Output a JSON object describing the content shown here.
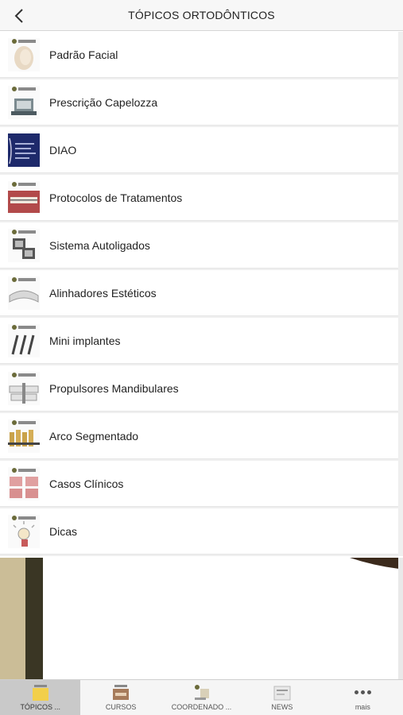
{
  "header": {
    "title": "TÓPICOS ORTODÔNTICOS",
    "back_icon": "chevron-left-icon"
  },
  "items": [
    {
      "label": "Padrão Facial",
      "icon": "facial-profile-thumb"
    },
    {
      "label": "Prescrição Capelozza",
      "icon": "bracket-thumb"
    },
    {
      "label": "DIAO",
      "icon": "diao-thumb"
    },
    {
      "label": "Protocolos de Tratamentos",
      "icon": "teeth-photo-thumb"
    },
    {
      "label": "Sistema Autoligados",
      "icon": "self-ligating-bracket-thumb"
    },
    {
      "label": "Alinhadores Estéticos",
      "icon": "aligner-thumb"
    },
    {
      "label": "Mini implantes",
      "icon": "mini-implant-thumb"
    },
    {
      "label": "Propulsores Mandibulares",
      "icon": "mandibular-propulsor-thumb"
    },
    {
      "label": "Arco Segmentado",
      "icon": "segmented-arch-thumb"
    },
    {
      "label": "Casos Clínicos",
      "icon": "clinical-cases-thumb"
    },
    {
      "label": "Dicas",
      "icon": "tips-thumb"
    }
  ],
  "tabs": [
    {
      "label": "TÓPICOS ...",
      "active": true,
      "icon": "topics-tab-icon"
    },
    {
      "label": "CURSOS",
      "active": false,
      "icon": "courses-tab-icon"
    },
    {
      "label": "COORDENADO ...",
      "active": false,
      "icon": "coordinator-tab-icon"
    },
    {
      "label": "NEWS",
      "active": false,
      "icon": "news-tab-icon"
    },
    {
      "label": "mais",
      "active": false,
      "icon": "more-icon"
    }
  ],
  "colors": {
    "header_bg": "#f7f7f7",
    "active_tab_bg": "#c9c9c9",
    "text": "#222222"
  }
}
